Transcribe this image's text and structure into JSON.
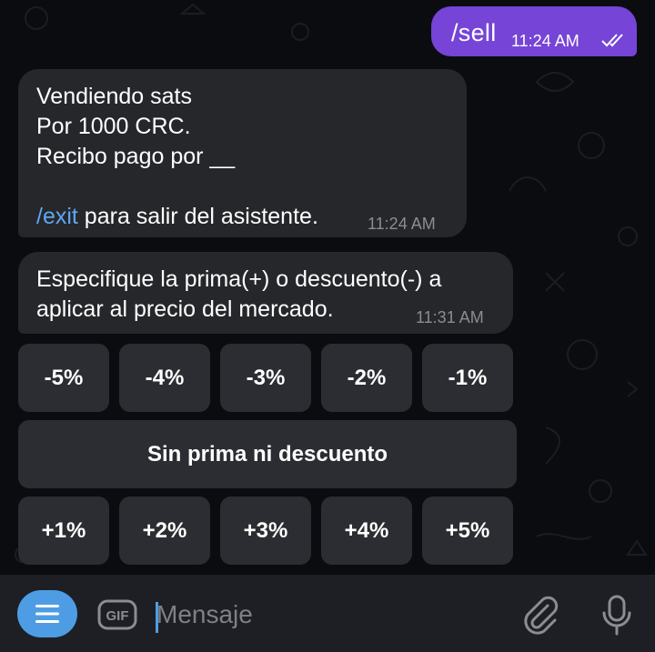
{
  "chat": {
    "outgoing": {
      "text": "/sell",
      "time": "11:24 AM",
      "status_icon": "double-check-icon"
    },
    "message_1": {
      "line1": "Vendiendo sats",
      "line2": "Por 1000 CRC.",
      "line3": "Recibo pago por __",
      "command": "/exit",
      "suffix": " para salir del asistente.",
      "time": "11:24 AM"
    },
    "message_2": {
      "line1": "Especifique la prima(+) o descuento(-) a",
      "line2": "aplicar al precio del mercado.",
      "time": "11:31 AM"
    }
  },
  "keyboard": {
    "row1": [
      "-5%",
      "-4%",
      "-3%",
      "-2%",
      "-1%"
    ],
    "middle": "Sin prima ni descuento",
    "row3": [
      "+1%",
      "+2%",
      "+3%",
      "+4%",
      "+5%"
    ]
  },
  "composer": {
    "placeholder": "Mensaje",
    "gif_label": "GIF",
    "menu_icon": "menu-icon",
    "attach_icon": "paperclip-icon",
    "mic_icon": "microphone-icon"
  },
  "colors": {
    "outgoing_bubble": "#7644d6",
    "incoming_bubble": "#26272b",
    "link": "#5fa6f3",
    "accent": "#4e9de4"
  }
}
